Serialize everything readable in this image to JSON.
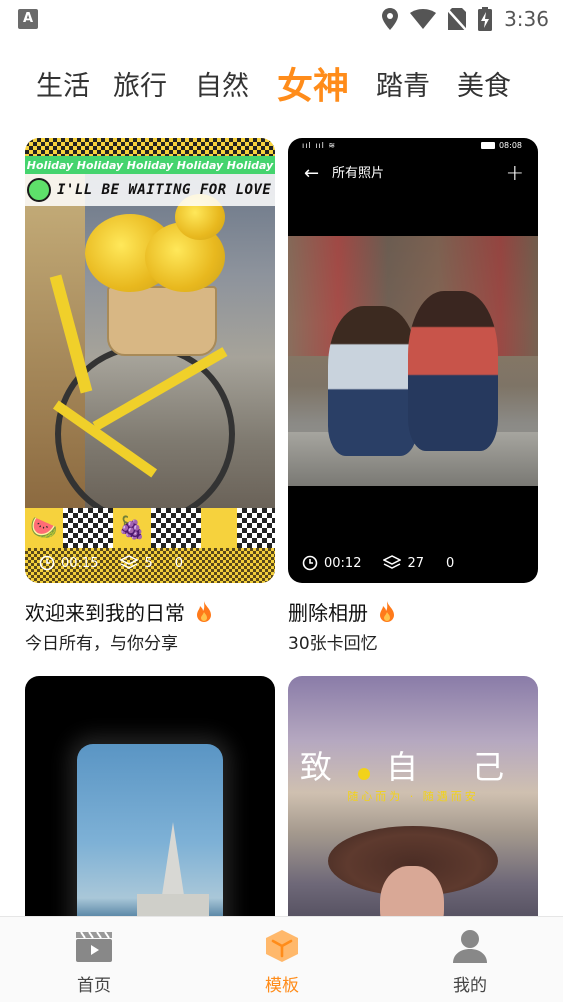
{
  "status_bar": {
    "app_badge": "A",
    "time": "3:36",
    "icons": [
      "location-icon",
      "wifi-icon",
      "no-sim-icon",
      "battery-charging-icon"
    ]
  },
  "tabs": [
    {
      "label": "生活",
      "active": false
    },
    {
      "label": "旅行",
      "active": false
    },
    {
      "label": "自然",
      "active": false
    },
    {
      "label": "女神",
      "active": true
    },
    {
      "label": "踏青",
      "active": false
    },
    {
      "label": "美食",
      "active": false
    }
  ],
  "cards": [
    {
      "holiday": "Holiday",
      "banner": "I'LL BE WAITING FOR LOVE",
      "duration": "00:15",
      "layers": "5",
      "count": "0",
      "title": "欢迎来到我的日常",
      "subtitle": "今日所有，与你分享",
      "hot_icon": "fire-icon",
      "tiles": [
        "🍉",
        "🍇"
      ]
    },
    {
      "inner_status_time": "08:08",
      "inner_nav_title": "所有照片",
      "duration": "00:12",
      "layers": "27",
      "count": "0",
      "title": "删除相册",
      "subtitle": "30张卡回忆",
      "hot_icon": "fire-icon"
    },
    {
      "title": "",
      "subtitle": ""
    },
    {
      "overlay_title": "致 自 己",
      "overlay_subtitle": "随心而为 · 随遇而安"
    }
  ],
  "bottom_nav": [
    {
      "label": "首页",
      "active": false,
      "icon": "clapperboard-icon"
    },
    {
      "label": "模板",
      "active": true,
      "icon": "template-hexagon-icon"
    },
    {
      "label": "我的",
      "active": false,
      "icon": "profile-icon"
    }
  ],
  "colors": {
    "accent": "#ff8c1a",
    "text": "#222222",
    "fire": "#ff7a1a"
  }
}
